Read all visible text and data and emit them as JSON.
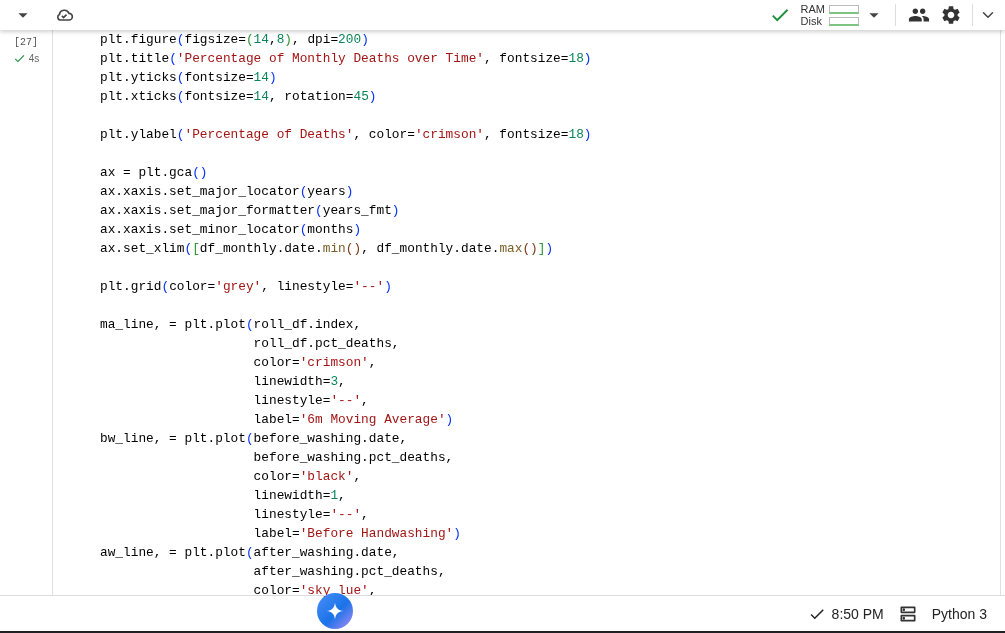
{
  "top_bar": {
    "ram_label": "RAM",
    "disk_label": "Disk",
    "connected": true
  },
  "cell": {
    "execution_count": "[27]",
    "duration": "4s",
    "succeeded": true,
    "lines": [
      {
        "tokens": [
          {
            "kind": "plain",
            "text": "plt.figure"
          },
          {
            "kind": "paren",
            "text": "("
          },
          {
            "kind": "plain",
            "text": "figsize="
          },
          {
            "kind": "bracket",
            "text": "("
          },
          {
            "kind": "number",
            "text": "14"
          },
          {
            "kind": "plain",
            "text": ","
          },
          {
            "kind": "number",
            "text": "8"
          },
          {
            "kind": "bracket",
            "text": ")"
          },
          {
            "kind": "plain",
            "text": ", dpi="
          },
          {
            "kind": "number",
            "text": "200"
          },
          {
            "kind": "paren",
            "text": ")"
          }
        ]
      },
      {
        "tokens": [
          {
            "kind": "plain",
            "text": "plt.title"
          },
          {
            "kind": "paren",
            "text": "("
          },
          {
            "kind": "string",
            "text": "'Percentage of Monthly Deaths over Time'"
          },
          {
            "kind": "plain",
            "text": ", fontsize="
          },
          {
            "kind": "number",
            "text": "18"
          },
          {
            "kind": "paren",
            "text": ")"
          }
        ]
      },
      {
        "tokens": [
          {
            "kind": "plain",
            "text": "plt.yticks"
          },
          {
            "kind": "paren",
            "text": "("
          },
          {
            "kind": "plain",
            "text": "fontsize="
          },
          {
            "kind": "number",
            "text": "14"
          },
          {
            "kind": "paren",
            "text": ")"
          }
        ]
      },
      {
        "tokens": [
          {
            "kind": "plain",
            "text": "plt.xticks"
          },
          {
            "kind": "paren",
            "text": "("
          },
          {
            "kind": "plain",
            "text": "fontsize="
          },
          {
            "kind": "number",
            "text": "14"
          },
          {
            "kind": "plain",
            "text": ", rotation="
          },
          {
            "kind": "number",
            "text": "45"
          },
          {
            "kind": "paren",
            "text": ")"
          }
        ]
      },
      {
        "kind": "blank"
      },
      {
        "tokens": [
          {
            "kind": "plain",
            "text": "plt.ylabel"
          },
          {
            "kind": "paren",
            "text": "("
          },
          {
            "kind": "string",
            "text": "'Percentage of Deaths'"
          },
          {
            "kind": "plain",
            "text": ", color="
          },
          {
            "kind": "string",
            "text": "'crimson'"
          },
          {
            "kind": "plain",
            "text": ", fontsize="
          },
          {
            "kind": "number",
            "text": "18"
          },
          {
            "kind": "paren",
            "text": ")"
          }
        ]
      },
      {
        "kind": "blank"
      },
      {
        "tokens": [
          {
            "kind": "plain",
            "text": "ax = plt.gca"
          },
          {
            "kind": "paren",
            "text": "()"
          }
        ]
      },
      {
        "tokens": [
          {
            "kind": "plain",
            "text": "ax.xaxis.set_major_locator"
          },
          {
            "kind": "paren",
            "text": "("
          },
          {
            "kind": "plain",
            "text": "years"
          },
          {
            "kind": "paren",
            "text": ")"
          }
        ]
      },
      {
        "tokens": [
          {
            "kind": "plain",
            "text": "ax.xaxis.set_major_formatter"
          },
          {
            "kind": "paren",
            "text": "("
          },
          {
            "kind": "plain",
            "text": "years_fmt"
          },
          {
            "kind": "paren",
            "text": ")"
          }
        ]
      },
      {
        "tokens": [
          {
            "kind": "plain",
            "text": "ax.xaxis.set_minor_locator"
          },
          {
            "kind": "paren",
            "text": "("
          },
          {
            "kind": "plain",
            "text": "months"
          },
          {
            "kind": "paren",
            "text": ")"
          }
        ]
      },
      {
        "tokens": [
          {
            "kind": "plain",
            "text": "ax.set_xlim"
          },
          {
            "kind": "paren",
            "text": "("
          },
          {
            "kind": "bracket",
            "text": "["
          },
          {
            "kind": "plain",
            "text": "df_monthly.date."
          },
          {
            "kind": "function",
            "text": "min"
          },
          {
            "kind": "inner",
            "text": "()"
          },
          {
            "kind": "plain",
            "text": ", df_monthly.date."
          },
          {
            "kind": "function",
            "text": "max"
          },
          {
            "kind": "inner",
            "text": "()"
          },
          {
            "kind": "bracket",
            "text": "]"
          },
          {
            "kind": "paren",
            "text": ")"
          }
        ]
      },
      {
        "kind": "blank"
      },
      {
        "tokens": [
          {
            "kind": "plain",
            "text": "plt.grid"
          },
          {
            "kind": "paren",
            "text": "("
          },
          {
            "kind": "plain",
            "text": "color="
          },
          {
            "kind": "string",
            "text": "'grey'"
          },
          {
            "kind": "plain",
            "text": ", linestyle="
          },
          {
            "kind": "string",
            "text": "'--'"
          },
          {
            "kind": "paren",
            "text": ")"
          }
        ]
      },
      {
        "kind": "blank"
      },
      {
        "tokens": [
          {
            "kind": "plain",
            "text": "ma_line, = plt.plot"
          },
          {
            "kind": "paren",
            "text": "("
          },
          {
            "kind": "plain",
            "text": "roll_df.index,"
          }
        ]
      },
      {
        "tokens": [
          {
            "kind": "plain",
            "text": "                    roll_df.pct_deaths,"
          }
        ]
      },
      {
        "tokens": [
          {
            "kind": "plain",
            "text": "                    color="
          },
          {
            "kind": "string",
            "text": "'crimson'"
          },
          {
            "kind": "plain",
            "text": ","
          }
        ]
      },
      {
        "tokens": [
          {
            "kind": "plain",
            "text": "                    linewidth="
          },
          {
            "kind": "number",
            "text": "3"
          },
          {
            "kind": "plain",
            "text": ","
          }
        ]
      },
      {
        "tokens": [
          {
            "kind": "plain",
            "text": "                    linestyle="
          },
          {
            "kind": "string",
            "text": "'--'"
          },
          {
            "kind": "plain",
            "text": ","
          }
        ]
      },
      {
        "tokens": [
          {
            "kind": "plain",
            "text": "                    label="
          },
          {
            "kind": "string",
            "text": "'6m Moving Average'"
          },
          {
            "kind": "paren",
            "text": ")"
          }
        ]
      },
      {
        "tokens": [
          {
            "kind": "plain",
            "text": "bw_line, = plt.plot"
          },
          {
            "kind": "paren",
            "text": "("
          },
          {
            "kind": "plain",
            "text": "before_washing.date,"
          }
        ]
      },
      {
        "tokens": [
          {
            "kind": "plain",
            "text": "                    before_washing.pct_deaths,"
          }
        ]
      },
      {
        "tokens": [
          {
            "kind": "plain",
            "text": "                    color="
          },
          {
            "kind": "string",
            "text": "'black'"
          },
          {
            "kind": "plain",
            "text": ","
          }
        ]
      },
      {
        "tokens": [
          {
            "kind": "plain",
            "text": "                    linewidth="
          },
          {
            "kind": "number",
            "text": "1"
          },
          {
            "kind": "plain",
            "text": ","
          }
        ]
      },
      {
        "tokens": [
          {
            "kind": "plain",
            "text": "                    linestyle="
          },
          {
            "kind": "string",
            "text": "'--'"
          },
          {
            "kind": "plain",
            "text": ","
          }
        ]
      },
      {
        "tokens": [
          {
            "kind": "plain",
            "text": "                    label="
          },
          {
            "kind": "string",
            "text": "'Before Handwashing'"
          },
          {
            "kind": "paren",
            "text": ")"
          }
        ]
      },
      {
        "tokens": [
          {
            "kind": "plain",
            "text": "aw_line, = plt.plot"
          },
          {
            "kind": "paren",
            "text": "("
          },
          {
            "kind": "plain",
            "text": "after_washing.date,"
          }
        ]
      },
      {
        "tokens": [
          {
            "kind": "plain",
            "text": "                    after_washing.pct_deaths,"
          }
        ]
      },
      {
        "tokens": [
          {
            "kind": "plain",
            "text": "                    color="
          },
          {
            "kind": "string",
            "text": "'sky"
          },
          {
            "kind": "string",
            "text": "lue'",
            "after_gap": true
          },
          {
            "kind": "plain",
            "text": ","
          }
        ]
      }
    ]
  },
  "status_bar": {
    "time": "8:50 PM",
    "runtime": "Python 3",
    "saved": true
  }
}
